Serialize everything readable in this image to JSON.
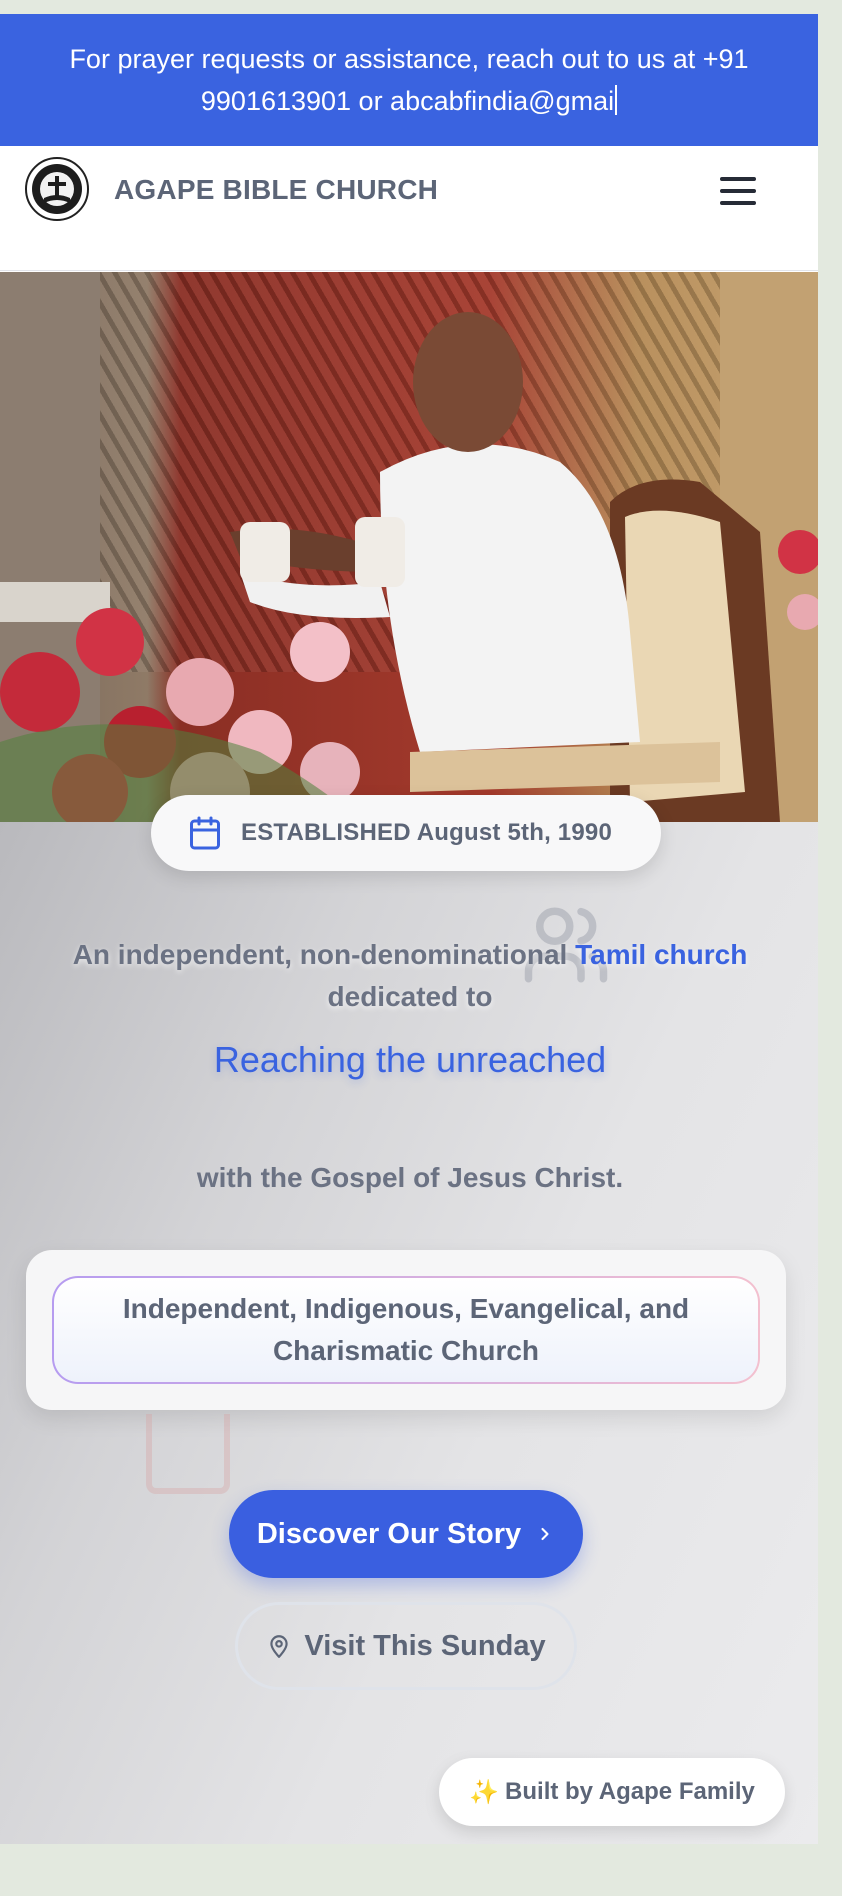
{
  "announcement": {
    "text": "For prayer requests or assistance, reach out to us at +91 9901613901 or abcabfindia@gmai"
  },
  "header": {
    "title": "AGAPE BIBLE CHURCH",
    "logo_text": "AGAPE BIBLE CHURCH"
  },
  "hero": {
    "established": "ESTABLISHED August 5th, 1990",
    "intro_prefix": "An independent, non-denominational",
    "intro_accent": "Tamil church",
    "intro_suffix": "dedicated to",
    "tagline": "Reaching the unreached",
    "gospel": "with the Gospel of Jesus Christ.",
    "card_text": "Independent, Indigenous, Evangelical, and Charismatic Church"
  },
  "actions": {
    "primary": "Discover Our Story",
    "secondary": "Visit This Sunday"
  },
  "footer_badge": {
    "spark": "✨",
    "text": "Built by Agape Family"
  },
  "colors": {
    "accent": "#3a63e0",
    "text_muted": "#5c6577",
    "page_bg": "#e3e9df"
  },
  "icons": [
    "church-logo",
    "menu-icon",
    "calendar-icon",
    "people-icon",
    "chevron-right-icon",
    "location-pin-icon",
    "sparkle-icon"
  ]
}
